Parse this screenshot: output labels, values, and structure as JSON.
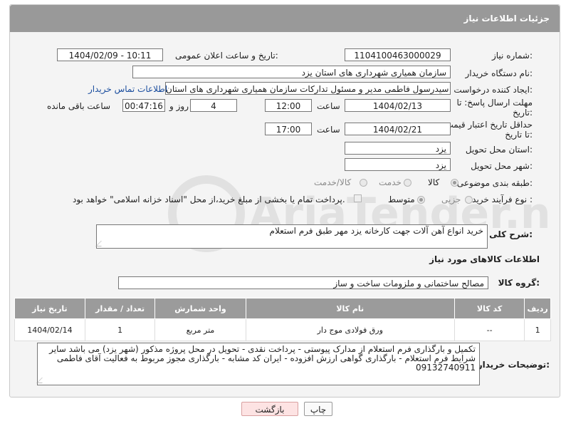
{
  "header": {
    "title": "جزئیات اطلاعات نیاز"
  },
  "fields": {
    "need_number_label": "شماره نیاز:",
    "need_number": "1104100463000029",
    "announce_label": "تاریخ و ساعت اعلان عمومی:",
    "announce_value": "1404/02/09 - 10:11",
    "buyer_org_label": "نام دستگاه خریدار:",
    "buyer_org": "سازمان همیاری شهرداری های استان یزد",
    "requester_label": "ایجاد کننده درخواست:",
    "requester": "سیدرسول فاطمی مدیر و مسئول تدارکات سازمان همیاری شهرداری های استان",
    "contact_link": "اطلاعات تماس خریدار",
    "deadline_label": "مهلت ارسال پاسخ: تا تاریخ:",
    "deadline_date": "1404/02/13",
    "time_label": "ساعت",
    "deadline_time": "12:00",
    "days": "4",
    "days_label": "روز و",
    "remaining_time": "00:47:16",
    "remaining_label": "ساعت باقی مانده",
    "price_validity_label": "حداقل تاریخ اعتبار قیمت: تا تاریخ:",
    "price_date": "1404/02/21",
    "price_time": "17:00",
    "province_label": "استان محل تحویل:",
    "province": "یزد",
    "city_label": "شهر محل تحویل:",
    "city": "یزد",
    "category_label": "طبقه بندی موضوعی:",
    "category_options": [
      "کالا",
      "خدمت",
      "کالا/خدمت"
    ],
    "process_label": "نوع فرآیند خرید :",
    "process_options": [
      "جزیی",
      "متوسط"
    ],
    "payment_note": "پرداخت تمام یا بخشی از مبلغ خرید،از محل \"اسناد خزانه اسلامی\" خواهد بود.",
    "description_label": "شرح کلی نیاز:",
    "description": "خرید انواع آهن آلات جهت کارخانه یزد مهر طبق فرم استعلام",
    "goods_info_title": "اطلاعات کالاهای مورد نیاز",
    "goods_group_label": "گروه کالا:",
    "goods_group": "مصالح ساختمانی و ملزومات ساخت و ساز",
    "buyer_notes_label": "توضیحات خریدار:",
    "buyer_notes": "تکمیل و بارگذاری فرم استعلام از مدارک پیوستی - پرداخت نقدی - تحویل در محل پروژه مذکور (شهر یزد) می باشد سایر شرایط فرم استعلام - بارگذاری گواهی ارزش افزوده - ایران کد مشابه - بارگذاری مجوز مربوط به فعالیت آقای فاطمی 09132740911"
  },
  "table": {
    "headers": [
      "ردیف",
      "کد کالا",
      "نام کالا",
      "واحد شمارش",
      "تعداد / مقدار",
      "تاریخ نیاز"
    ],
    "rows": [
      [
        "1",
        "--",
        "ورق فولادی موج دار",
        "متر مربع",
        "1",
        "1404/02/14"
      ]
    ]
  },
  "buttons": {
    "print": "چاپ",
    "back": "بازگشت"
  },
  "watermark": "AriaTender.net"
}
